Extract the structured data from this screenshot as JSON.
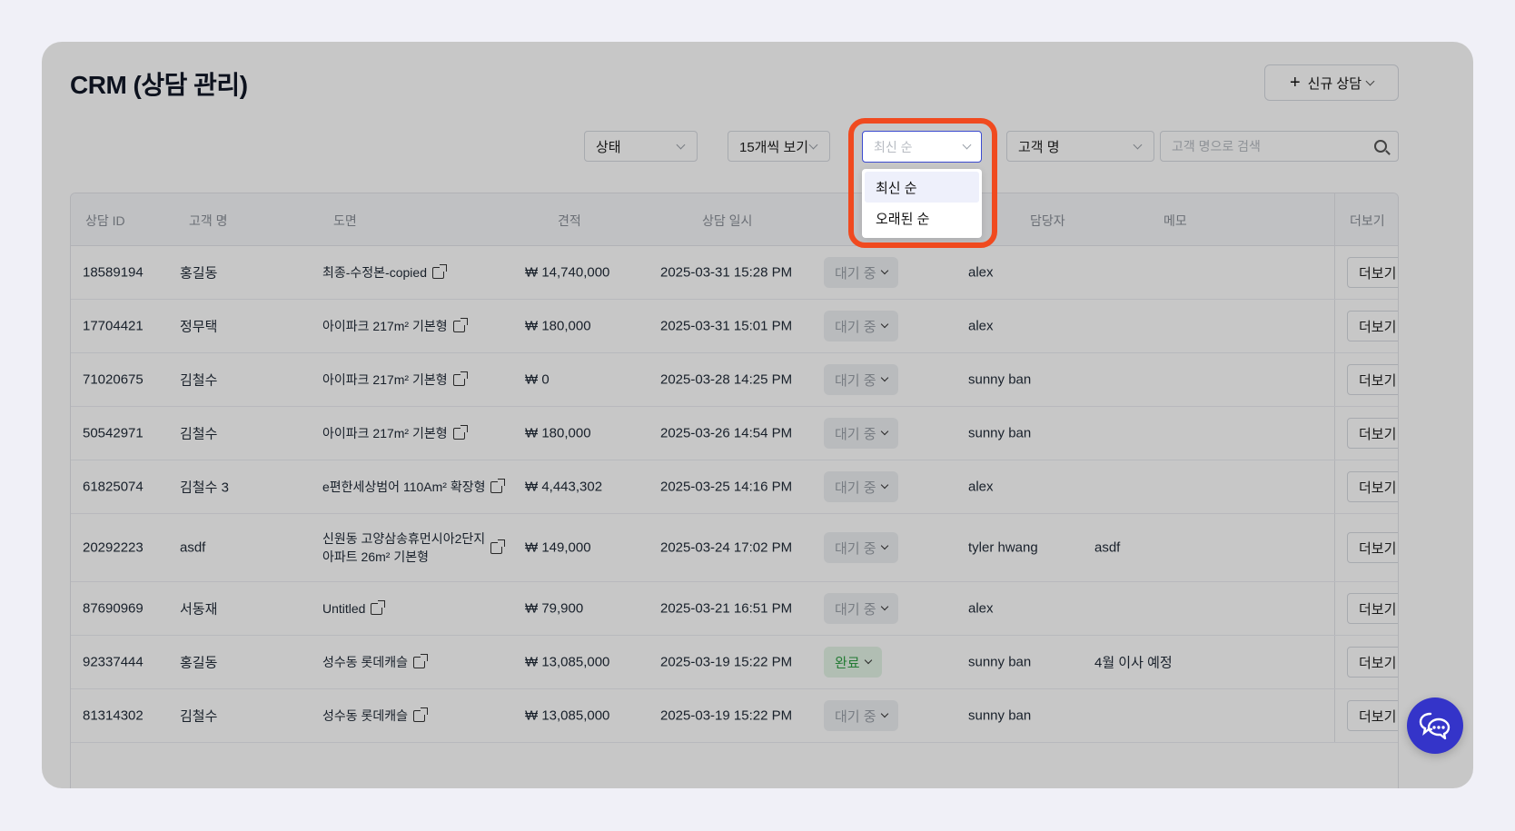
{
  "header": {
    "title": "CRM (상담 관리)",
    "new_button": "신규 상담"
  },
  "filters": {
    "status_label": "상태",
    "page_size_label": "15개씩 보기",
    "sort_placeholder": "최신 순",
    "customer_field_label": "고객 명",
    "search_placeholder": "고객 명으로 검색"
  },
  "sort_menu": {
    "options": [
      "최신 순",
      "오래된 순"
    ],
    "active_index": 0
  },
  "table": {
    "headers": [
      "상담 ID",
      "고객 명",
      "도면",
      "견적",
      "상담 일시",
      "담당자",
      "메모",
      "더보기"
    ],
    "more_label": "더보기",
    "rows": [
      {
        "id": "18589194",
        "customer": "홍길동",
        "drawing": "최종-수정본-copied",
        "drawing2": "",
        "estimate": "₩ 14,740,000",
        "datetime": "2025-03-31 15:28 PM",
        "status": "대기 중",
        "owner": "alex",
        "memo": ""
      },
      {
        "id": "17704421",
        "customer": "정무택",
        "drawing": "아이파크 217m² 기본형",
        "drawing2": "",
        "estimate": "₩ 180,000",
        "datetime": "2025-03-31 15:01 PM",
        "status": "대기 중",
        "owner": "alex",
        "memo": ""
      },
      {
        "id": "71020675",
        "customer": "김철수",
        "drawing": "아이파크 217m² 기본형",
        "drawing2": "",
        "estimate": "₩ 0",
        "datetime": "2025-03-28 14:25 PM",
        "status": "대기 중",
        "owner": "sunny ban",
        "memo": ""
      },
      {
        "id": "50542971",
        "customer": "김철수",
        "drawing": "아이파크 217m² 기본형",
        "drawing2": "",
        "estimate": "₩ 180,000",
        "datetime": "2025-03-26 14:54 PM",
        "status": "대기 중",
        "owner": "sunny ban",
        "memo": ""
      },
      {
        "id": "61825074",
        "customer": "김철수 3",
        "drawing": "e편한세상범어 110Am² 확장형",
        "drawing2": "",
        "estimate": "₩ 4,443,302",
        "datetime": "2025-03-25 14:16 PM",
        "status": "대기 중",
        "owner": "alex",
        "memo": ""
      },
      {
        "id": "20292223",
        "customer": "asdf",
        "drawing": "신원동 고양삼송휴먼시아2단지",
        "drawing2": "아파트 26m² 기본형",
        "estimate": "₩ 149,000",
        "datetime": "2025-03-24 17:02 PM",
        "status": "대기 중",
        "owner": "tyler hwang",
        "memo": "asdf"
      },
      {
        "id": "87690969",
        "customer": "서동재",
        "drawing": "Untitled",
        "drawing2": "",
        "estimate": "₩ 79,900",
        "datetime": "2025-03-21 16:51 PM",
        "status": "대기 중",
        "owner": "alex",
        "memo": ""
      },
      {
        "id": "92337444",
        "customer": "홍길동",
        "drawing": "성수동 롯데캐슬",
        "drawing2": "",
        "estimate": "₩ 13,085,000",
        "datetime": "2025-03-19 15:22 PM",
        "status": "완료",
        "owner": "sunny ban",
        "memo": "4월 이사 예정"
      },
      {
        "id": "81314302",
        "customer": "김철수",
        "drawing": "성수동 롯데캐슬",
        "drawing2": "",
        "estimate": "₩ 13,085,000",
        "datetime": "2025-03-19 15:22 PM",
        "status": "대기 중",
        "owner": "sunny ban",
        "memo": ""
      }
    ]
  },
  "colors": {
    "accent": "#3434c9",
    "highlight": "#f04a1f",
    "done": "#2f9e44"
  },
  "icons": {
    "chat": "chat-bubbles-icon",
    "external": "external-link-icon",
    "search": "search-icon"
  }
}
